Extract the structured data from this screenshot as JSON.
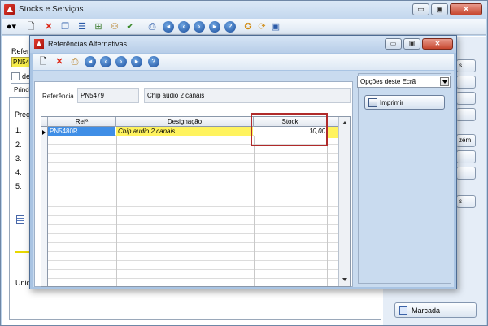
{
  "main_window": {
    "title": "Stocks e Serviços",
    "caption_min": "▭",
    "caption_max": "▣",
    "caption_close": "✕",
    "reference_label": "Refer",
    "reference_code": "PN54",
    "checkbox_label": "de",
    "tab_label": "Princi",
    "price_label": "Preço",
    "rows": [
      "1.",
      "2.",
      "3.",
      "4.",
      "5."
    ],
    "units_label": "Unida",
    "side_buttons": [
      "s",
      "",
      "",
      "",
      "zém",
      "",
      "",
      "s"
    ],
    "marcada_button": "Marcada"
  },
  "dialog": {
    "title": "Referências Alternativas",
    "caption_min": "▭",
    "caption_max": "▣",
    "caption_close": "✕",
    "reference_label": "Referência",
    "reference_code": "PN5479",
    "reference_description": "Chip audio 2 canais",
    "options_select": "Opções deste Ecrã",
    "print_button": "Imprimir",
    "grid": {
      "columns": [
        "Refª",
        "Designação",
        "Stock"
      ],
      "rows": [
        {
          "ref": "PN5480R",
          "designacao": "Chip audio 2 canais",
          "stock": "10,00"
        }
      ]
    }
  },
  "colors": {
    "selected_cell": "#3f8ee6",
    "highlight_yellow": "#fff35e",
    "annotation_red": "#b02a2a"
  }
}
